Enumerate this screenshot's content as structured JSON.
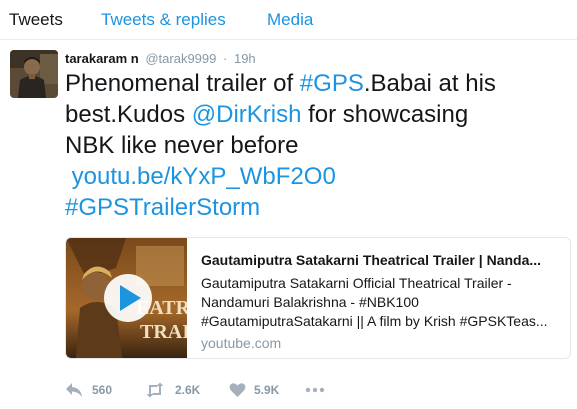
{
  "tabs": {
    "tweets": "Tweets",
    "replies": "Tweets & replies",
    "media": "Media"
  },
  "tweet": {
    "name": "tarakaram n",
    "handle": "@tarak9999",
    "separator": "·",
    "time": "19h",
    "text": {
      "l1_a": "Phenomenal trailer of ",
      "l1_hashtag": "#GPS",
      "l1_b": ".Babai at his",
      "l2_a": "best.Kudos ",
      "l2_mention": "@DirKrish",
      "l2_b": " for showcasing",
      "l3": "NBK like never before",
      "l4_link": "youtu.be/kYxP_WbF2O0",
      "l5_hashtag": "#GPSTrailerStorm"
    },
    "card": {
      "title": "Gautamiputra Satakarni Theatrical Trailer | Nanda...",
      "desc_1": "Gautamiputra Satakarni Official Theatrical Trailer -",
      "desc_2": "Nandamuri Balakrishna - #NBK100",
      "desc_3": "#GautamiputraSatakarni || A film by Krish #GPSKTeas...",
      "domain": "youtube.com",
      "thumb_text_1": "EATR",
      "thumb_text_2": "TRAIL"
    },
    "actions": {
      "reply_count": "560",
      "retweet_count": "2.6K",
      "like_count": "5.9K"
    }
  },
  "colors": {
    "link": "#1c94e0",
    "muted": "#8899a6",
    "text": "#14171a",
    "border": "#e1e8ed"
  }
}
